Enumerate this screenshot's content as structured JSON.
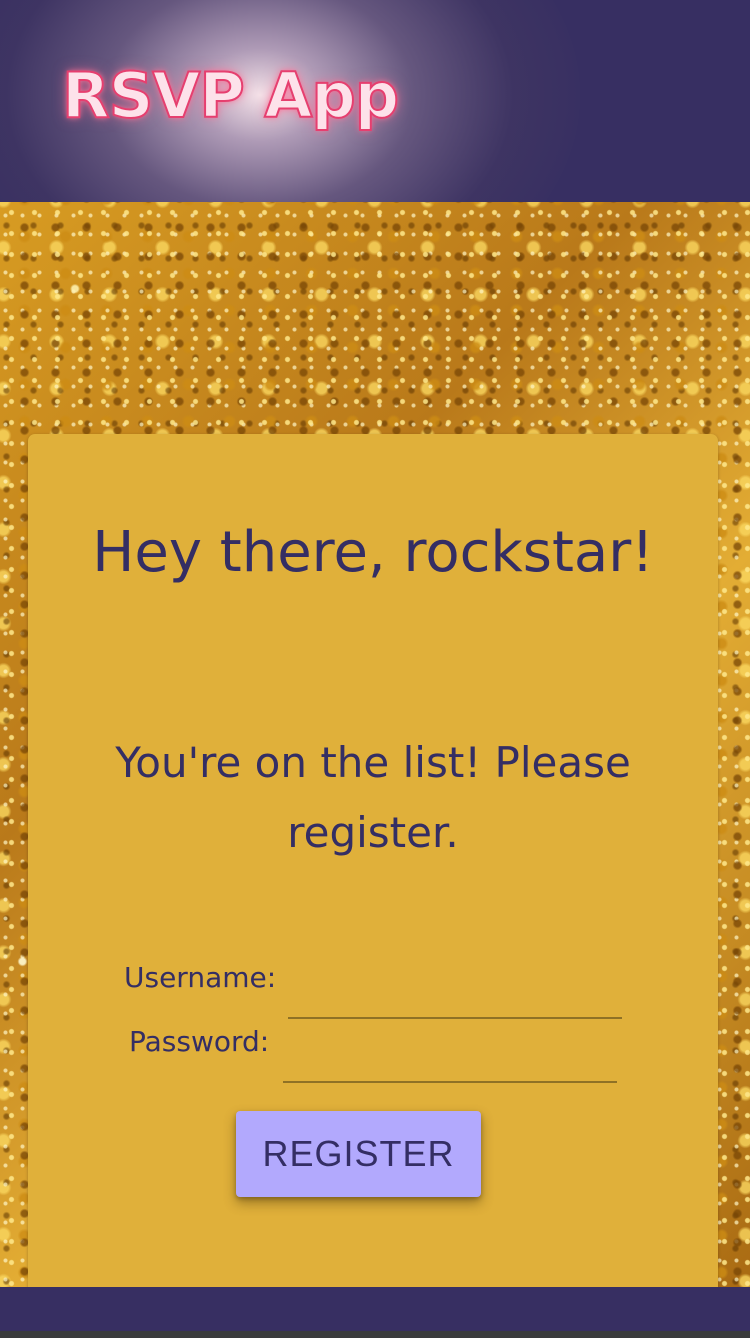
{
  "app": {
    "title": "RSVP App"
  },
  "card": {
    "heading": "Hey there, rockstar!",
    "subheading": "You're on the list! Please register."
  },
  "form": {
    "username_label": "Username:",
    "password_label": "Password:",
    "username_value": "",
    "password_value": "",
    "register_label": "REGISTER"
  },
  "colors": {
    "header_background": "#372f62",
    "card_background": "#e0b03a",
    "text": "#342e64",
    "button_background": "#b2a9fd",
    "logo_neon": "#e63f6f"
  }
}
